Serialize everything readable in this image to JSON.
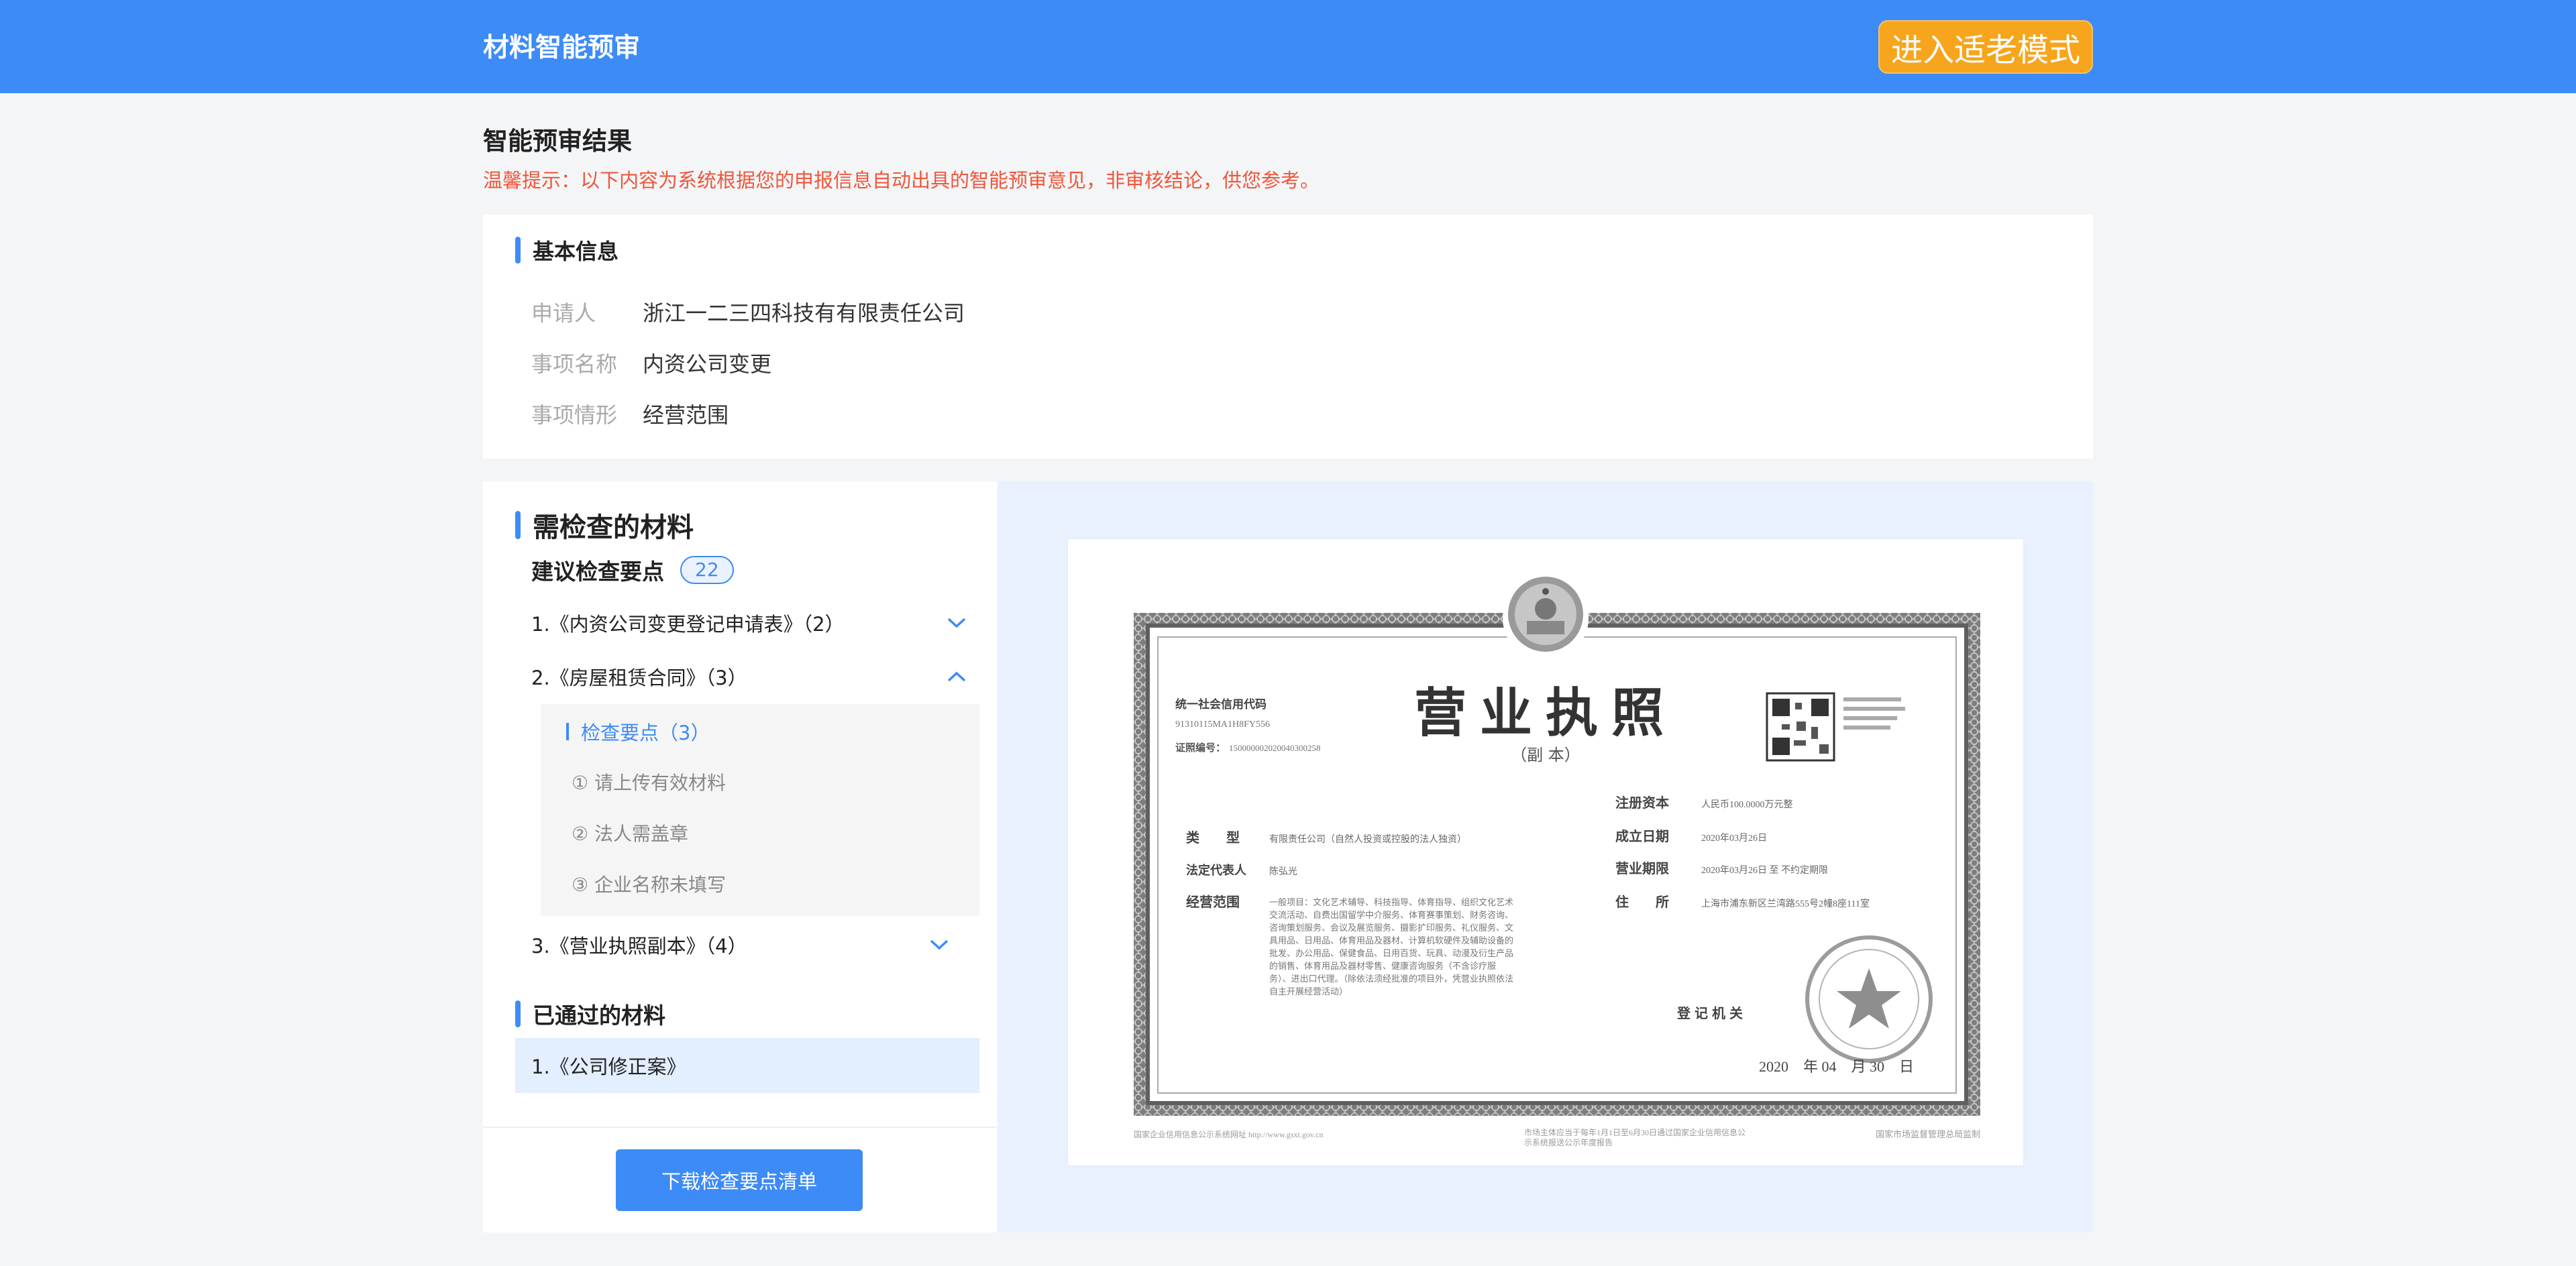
{
  "header": {
    "title": "材料智能预审",
    "elder_mode_button": "进入适老模式"
  },
  "page": {
    "heading": "智能预审结果",
    "tip": "温馨提示：以下内容为系统根据您的申报信息自动出具的智能预审意见，非审核结论，供您参考。"
  },
  "basic_info": {
    "title": "基本信息",
    "rows": [
      {
        "label": "申请人",
        "value": "浙江一二三四科技有有限责任公司"
      },
      {
        "label": "事项名称",
        "value": "内资公司变更"
      },
      {
        "label": "事项情形",
        "value": "经营范围"
      }
    ]
  },
  "materials": {
    "title": "需检查的材料",
    "suggest_label": "建议检查要点",
    "suggest_count": "22",
    "items": [
      {
        "label": "1.《内资公司变更登记申请表》（2）",
        "expanded": false
      },
      {
        "label": "2.《房屋租赁合同》（3）",
        "expanded": true
      },
      {
        "label": "3.《营业执照副本》（4）",
        "expanded": false
      }
    ],
    "sub": {
      "header": "检查要点（3）",
      "points": [
        "① 请上传有效材料",
        "② 法人需盖章",
        "③ 企业名称未填写"
      ]
    },
    "passed_title": "已通过的材料",
    "passed_items": [
      "1.《公司修正案》"
    ],
    "download_button": "下载检查要点清单"
  },
  "license": {
    "title": "营业执照",
    "subtitle": "（副 本）",
    "credit_code_label": "统一社会信用代码",
    "credit_code": "91310115MA1H8FY556",
    "cert_no_label": "证照编号：",
    "cert_no": "150000002020040300258",
    "fields_left": [
      {
        "label": "类　　型",
        "value": "有限责任公司（自然人投资或控股的法人独资）"
      },
      {
        "label": "法定代表人",
        "value": "陈弘光"
      },
      {
        "label": "经营范围",
        "value": "一般项目：文化艺术辅导、科技指导、体育指导、组织文化艺术交流活动、自费出国留学中介服务、体育赛事策划、财务咨询、咨询策划服务、会议及展览服务、摄影扩印服务、礼仪服务、文具用品、日用品、体育用品及器材、计算机软硬件及辅助设备的批发、办公用品、保健食品、日用百货、玩具、动漫及衍生产品的销售、体育用品及器材零售、健康咨询服务（不含诊疗服务）、进出口代理。（除依法须经批准的项目外，凭营业执照依法自主开展经营活动）"
      }
    ],
    "fields_right": [
      {
        "label": "注册资本",
        "value": "人民币100.0000万元整"
      },
      {
        "label": "成立日期",
        "value": "2020年03月26日"
      },
      {
        "label": "营业期限",
        "value": "2020年03月26日 至 不约定期限"
      },
      {
        "label": "住　　所",
        "value": "上海市浦东新区兰湾路555号2幢8座111室"
      }
    ],
    "authority": "登记机关",
    "date": "2020　年 04　月 30　日",
    "footer_left": "国家企业信用信息公示系统网址 http://www.gsxt.gov.cn",
    "footer_mid": "市场主体应当于每年1月1日至6月30日通过国家企业信用信息公示系统报送公示年度报告",
    "footer_right": "国家市场监督管理总局监制",
    "colors": {
      "frame": "#8a8a8a",
      "stamp": "#b0b0b0"
    }
  }
}
